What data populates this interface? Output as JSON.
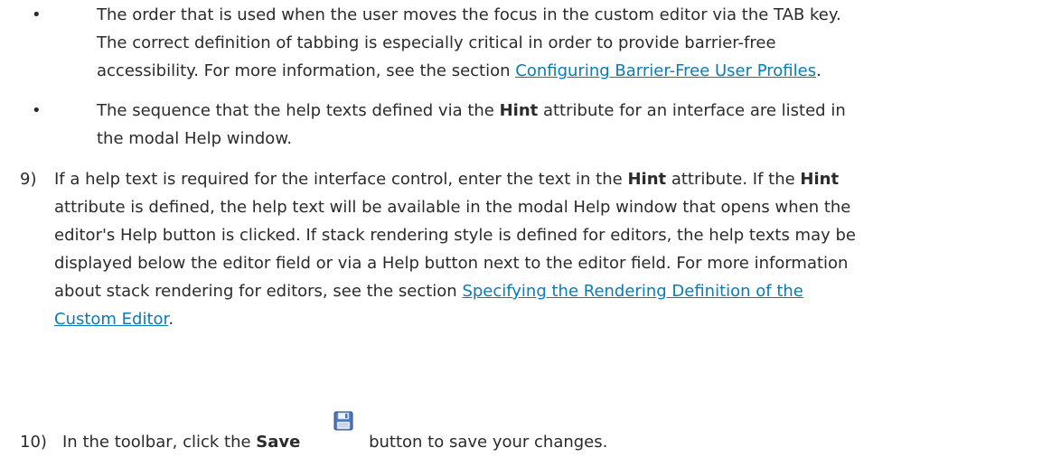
{
  "bullets": [
    {
      "marker": "•",
      "line1": "The order that is used when the user moves the focus in the custom editor via the TAB key.",
      "line2": "The correct definition of tabbing is especially critical in order to provide barrier-free",
      "line3_before": "accessibility. For more information, see the section ",
      "line3_link": "Configuring Barrier-Free User Profiles",
      "line3_after": "."
    },
    {
      "marker": "•",
      "line1_before": "The sequence that the help texts defined via the ",
      "line1_bold": "Hint",
      "line1_after": " attribute for an interface are listed in",
      "line2": "the modal Help window."
    }
  ],
  "step9": {
    "number": "9)",
    "line1_before": "If a help text is required for the interface control, enter the text in the ",
    "line1_bold1": "Hint",
    "line1_mid": " attribute. If the ",
    "line1_bold2": "Hint",
    "line2": "attribute is defined, the help text will be available in the modal Help window that opens when the",
    "line3": "editor's Help button is clicked. If stack rendering style is defined for editors, the help texts may be",
    "line4": "displayed below the editor field or via a Help button next to the editor field. For more information",
    "line5_before": "about stack rendering for editors, see the section ",
    "line5_link": "Specifying the Rendering Definition of the ",
    "line6_link": "Custom Editor",
    "line6_after": "."
  },
  "step10": {
    "number": "10)",
    "before": "In the toolbar, click the ",
    "bold": "Save",
    "after": " button to save your changes.",
    "icon": "save-icon"
  }
}
